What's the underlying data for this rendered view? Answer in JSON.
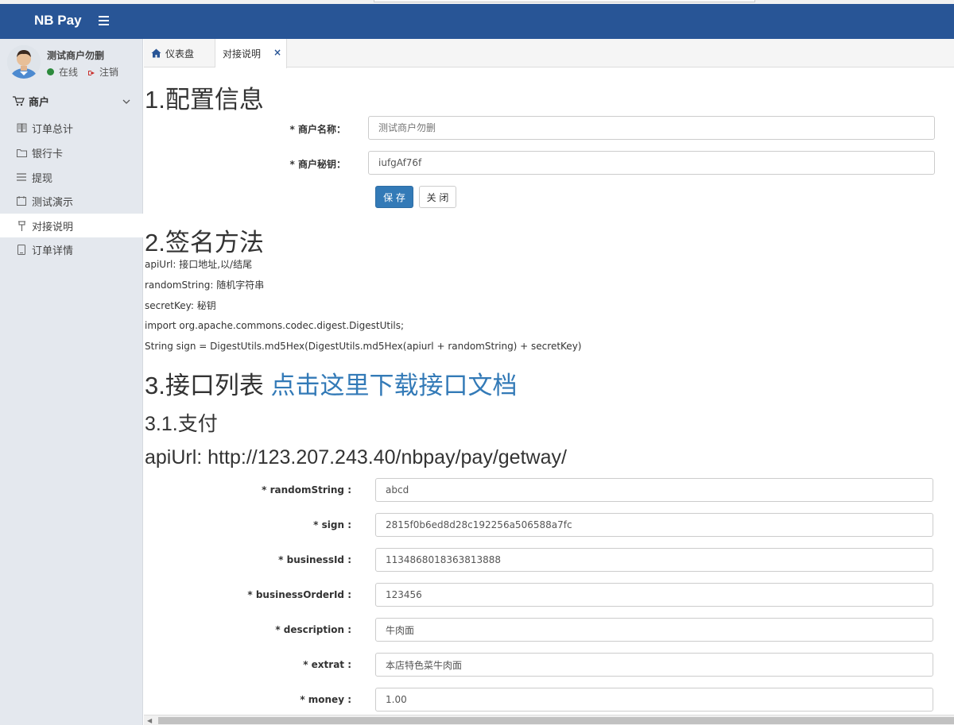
{
  "header": {
    "brand": "NB Pay"
  },
  "user": {
    "name": "测试商户勿删",
    "status": "在线",
    "logout": "注销"
  },
  "sidebar": {
    "group_label": "商户",
    "items": [
      {
        "label": "订单总计",
        "icon": "book-icon"
      },
      {
        "label": "银行卡",
        "icon": "folder-icon"
      },
      {
        "label": "提现",
        "icon": "list-icon"
      },
      {
        "label": "测试演示",
        "icon": "calendar-icon"
      },
      {
        "label": "对接说明",
        "icon": "pushpin-icon",
        "active": true
      },
      {
        "label": "订单详情",
        "icon": "phone-icon"
      }
    ]
  },
  "tabs": [
    {
      "label": "仪表盘",
      "icon": "home-icon"
    },
    {
      "label": "对接说明",
      "close": "×"
    }
  ],
  "section1": {
    "title": "1.配置信息",
    "fields": [
      {
        "label": "* 商户名称：",
        "placeholder": "测试商户勿删"
      },
      {
        "label": "* 商户秘钥：",
        "value": "iufgAf76f"
      }
    ],
    "save": "保 存",
    "close": "关 闭"
  },
  "section2": {
    "title": "2.签名方法",
    "lines": [
      "apiUrl: 接口地址,以/结尾",
      "randomString: 随机字符串",
      "secretKey: 秘钥",
      "import org.apache.commons.codec.digest.DigestUtils;",
      "String sign = DigestUtils.md5Hex(DigestUtils.md5Hex(apiurl + randomString) + secretKey)"
    ]
  },
  "section3": {
    "title": "3.接口列表 ",
    "link": "点击这里下载接口文档",
    "sub": "3.1.支付",
    "api": "apiUrl: http://123.207.243.40/nbpay/pay/getway/",
    "fields": [
      {
        "label": "* randomString :",
        "value": "abcd"
      },
      {
        "label": "* sign :",
        "value": "2815f0b6ed8d28c192256a506588a7fc"
      },
      {
        "label": "* businessId :",
        "value": "1134868018363813888"
      },
      {
        "label": "* businessOrderId :",
        "value": "123456"
      },
      {
        "label": "* description :",
        "value": "牛肉面"
      },
      {
        "label": "* extrat :",
        "value": "本店特色菜牛肉面"
      },
      {
        "label": "* money :",
        "value": "1.00"
      }
    ]
  }
}
